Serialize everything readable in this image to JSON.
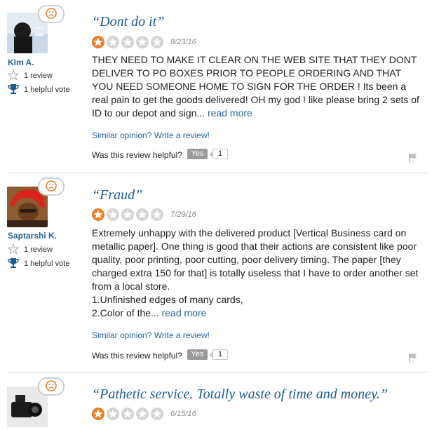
{
  "reviews": [
    {
      "username": "Klm A.",
      "review_count": "1 review",
      "helpful_votes": "1 helpful vote",
      "title": "“Dont do it”",
      "rating": 1,
      "rating_max": 5,
      "date": "8/23/16",
      "body_lines": [
        "THEY NEED TO MAKE IT CLEAR ON THE WEB SITE THAT THEY DONT DELIVER TO PO BOXES PRIOR TO PEOPLE ORDERING AND THAT YOU NEED SOMEONE HOME TO SIGN FOR THE ORDER ! Its been a real pain to get the goods delivered! OH my god ! like please bring 2 sets of ID to our depot and sign..."
      ],
      "read_more": "read more",
      "similar_opinion": "Similar opinion? Write a review!",
      "helpful_question": "Was this review helpful?",
      "yes_label": "Yes",
      "yes_count": "1"
    },
    {
      "username": "Saptarshi K.",
      "review_count": "1 review",
      "helpful_votes": "1 helpful vote",
      "title": "“Fraud”",
      "rating": 1,
      "rating_max": 5,
      "date": "7/29/16",
      "body_lines": [
        "Extremely unhappy with the delivered product [Vertical Business card on metallic paper]. One thing is good that their actions are consistent like poor quality, poor printing, poor cutting, poor delivery timing. The paper [they charged extra 150 for that] is totally useless that I have to order another set from a local store.",
        "1.Unfinished edges of many cards,",
        "2.Color of the..."
      ],
      "read_more": "read more",
      "similar_opinion": "Similar opinion? Write a review!",
      "helpful_question": "Was this review helpful?",
      "yes_label": "Yes",
      "yes_count": "1"
    },
    {
      "title": "“Pathetic service. Totally waste of time and money.”",
      "rating": 1,
      "rating_max": 5,
      "date": "6/15/16"
    }
  ],
  "colors": {
    "accent": "#1f5d8c",
    "link": "#2a6496",
    "star_filled": "#e6832a",
    "star_empty": "#d5d5d5",
    "yes_button": "#9a9a9a"
  },
  "icons": {
    "bubble": "frowning-face-icon",
    "review_count": "star-outline-icon",
    "helpful_votes": "trophy-icon",
    "report": "flag-icon"
  }
}
